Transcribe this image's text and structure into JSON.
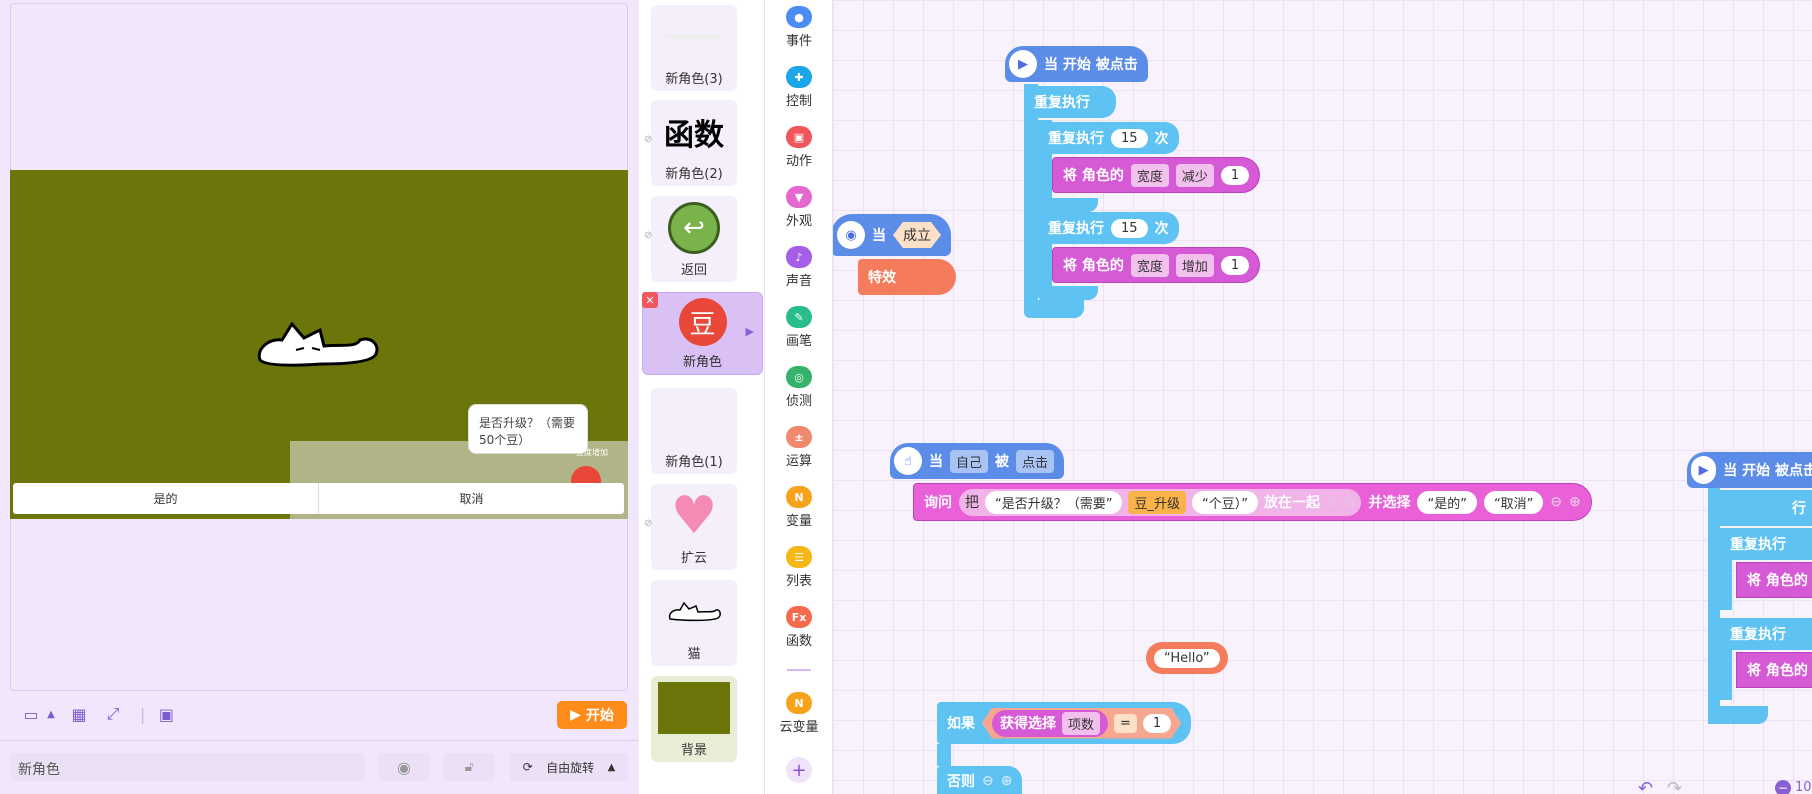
{
  "stage": {
    "bubble_text": "是否升级？（需要50个豆）",
    "bubble_label": "豆度增加",
    "ask_options": [
      "是的",
      "取消"
    ],
    "start_label": "开始"
  },
  "bottom_bar": {
    "sprite_name": "新角色",
    "rotation_label": "自由旋转"
  },
  "sprites": [
    {
      "name": "新角色(3)"
    },
    {
      "name": "新角色(2)",
      "thumb_text": "函数"
    },
    {
      "name": "返回"
    },
    {
      "name": "新角色",
      "thumb_text": "豆",
      "selected": true
    },
    {
      "name": "新角色(1)"
    },
    {
      "name": "扩云"
    },
    {
      "name": "猫"
    },
    {
      "name": "背景"
    }
  ],
  "categories": [
    {
      "label": "事件",
      "color": "#4e8cf5"
    },
    {
      "label": "控制",
      "color": "#1aa6e8"
    },
    {
      "label": "动作",
      "color": "#f0565c"
    },
    {
      "label": "外观",
      "color": "#e468ce"
    },
    {
      "label": "声音",
      "color": "#a55ee8"
    },
    {
      "label": "画笔",
      "color": "#28bd8b"
    },
    {
      "label": "侦测",
      "color": "#35b36b"
    },
    {
      "label": "运算",
      "color": "#f08a6e"
    },
    {
      "label": "变量",
      "color": "#f7a21b"
    },
    {
      "label": "列表",
      "color": "#f5b714"
    },
    {
      "label": "函数",
      "color": "#f36b4c"
    },
    {
      "label": "云变量",
      "color": "#f7a21b"
    }
  ],
  "scripts": {
    "start_clicked": "当 开始 被点击",
    "repeat_forever": "重复执行",
    "repeat_label": "重复执行",
    "times_label": "次",
    "repeat_count": "15",
    "set_prefix": "将 角色的",
    "prop_width": "宽度",
    "op_decrease": "减少",
    "op_increase": "增加",
    "amount": "1",
    "when_label": "当",
    "cond_label": "成立",
    "effect_label": "特效",
    "self_label": "自己",
    "by_label": "被",
    "click_label": "点击",
    "ask_label": "询问",
    "join_prefix": "把",
    "str1": "是否升级？（需要",
    "var_upgrade": "豆_升级",
    "str2": "个豆）",
    "join_suffix": "放在一起",
    "choose_label": "并选择",
    "choice1": "是的",
    "choice2": "取消",
    "hello": "Hello",
    "if_label": "如果",
    "get_choice": "获得选择",
    "item_label": "项数",
    "eq": "=",
    "eq_val": "1",
    "else_label": "否则",
    "right_start": "当 开始 被点击",
    "right_forever": "行",
    "right_repeat": "重复执行",
    "right_set": "将 角色的",
    "zoom": "10"
  }
}
